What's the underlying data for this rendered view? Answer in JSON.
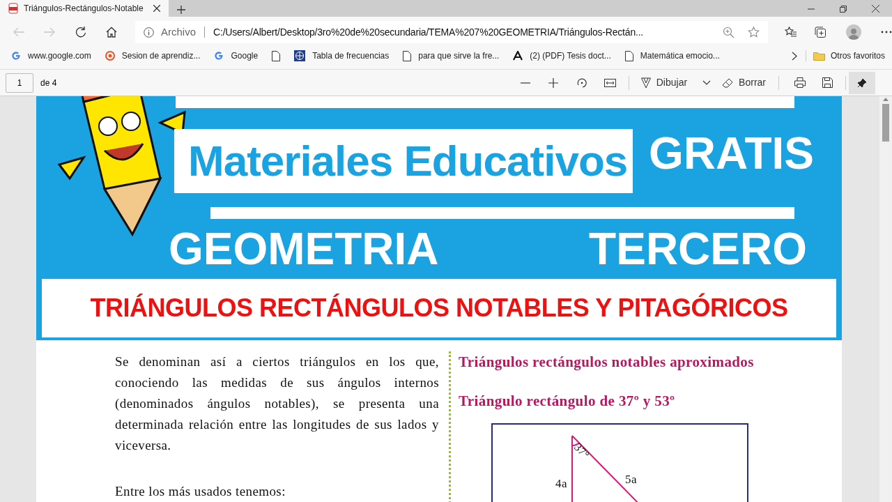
{
  "tab": {
    "title": "Triángulos-Rectángulos-Notable",
    "selected": true
  },
  "address_bar": {
    "scheme_label": "Archivo",
    "url": "C:/Users/Albert/Desktop/3ro%20de%20secundaria/TEMA%207%20GEOMETRIA/Triángulos-Rectán..."
  },
  "bookmarks": [
    {
      "kind": "google",
      "label": "www.google.com"
    },
    {
      "kind": "target",
      "label": "Sesion de aprendiz..."
    },
    {
      "kind": "google",
      "label": "Google"
    },
    {
      "kind": "page"
    },
    {
      "kind": "globe",
      "label": "Tabla de frecuencias"
    },
    {
      "kind": "page",
      "label": "para que sirve la fre..."
    },
    {
      "kind": "letter",
      "label": "(2) (PDF) Tesis doct..."
    },
    {
      "kind": "page",
      "label": "Matemática emocio..."
    }
  ],
  "other_bookmarks": "Otros favoritos",
  "pdf_toolbar": {
    "page": "1",
    "page_count": "de 4",
    "draw": "Dibujar",
    "erase": "Borrar"
  },
  "document": {
    "banner": {
      "brand": "Materiales Educativos",
      "free": "GRATIS",
      "subject": "GEOMETRIA",
      "grade": "TERCERO"
    },
    "title": "TRIÁNGULOS RECTÁNGULOS NOTABLES Y PITAGÓRICOS",
    "left_paragraphs": [
      "Se denominan así a ciertos triángulos en los que, conociendo las medidas de sus ángulos internos (denominados ángulos notables), se presenta una determinada relación entre las longitudes de sus lados y viceversa.",
      "Entre los más usados tenemos:"
    ],
    "section_heading": "Triángulos rectángulos notables aproximados",
    "subsection_heading": "Triángulo rectángulo de 37º y 53º",
    "figure": {
      "angle": "37°",
      "vertical_side": "4a",
      "hypotenuse": "5a"
    }
  }
}
